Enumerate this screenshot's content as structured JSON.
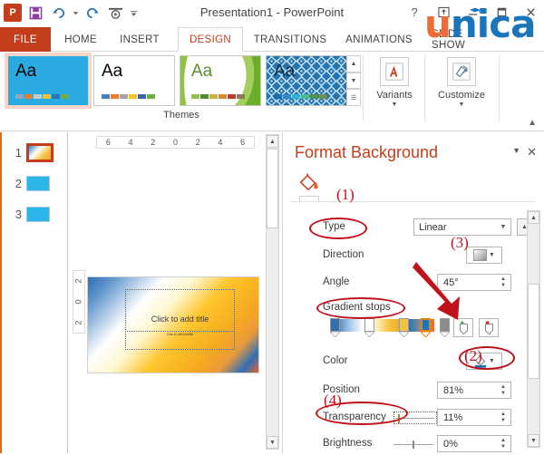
{
  "window": {
    "title": "Presentation1 - PowerPoint",
    "app_logo": "P",
    "quick_access": [
      {
        "name": "save-icon",
        "glyph": "ὋE"
      },
      {
        "name": "undo-icon",
        "glyph": "↶"
      },
      {
        "name": "redo-icon",
        "glyph": "↻"
      },
      {
        "name": "start-slideshow-icon",
        "glyph": "▷"
      },
      {
        "name": "customize-qat-icon",
        "glyph": "▾"
      }
    ],
    "controls": [
      {
        "name": "help-button",
        "glyph": "?"
      },
      {
        "name": "ribbon-display-options-button",
        "glyph": "⬆"
      },
      {
        "name": "minimize-button",
        "glyph": "–"
      },
      {
        "name": "restore-button",
        "glyph": "❐"
      },
      {
        "name": "close-button",
        "glyph": "✕"
      }
    ]
  },
  "watermark": {
    "first_letter": "u",
    "rest": "nica",
    "color_orange": "#ef6a35",
    "color_blue": "#1b75bb"
  },
  "tabs": {
    "file": "FILE",
    "items": [
      {
        "label": "HOME",
        "active": false
      },
      {
        "label": "INSERT",
        "active": false
      },
      {
        "label": "DESIGN",
        "active": true
      },
      {
        "label": "TRANSITIONS",
        "active": false
      },
      {
        "label": "ANIMATIONS",
        "active": false
      },
      {
        "label": "SLIDE SHOW",
        "active": false
      }
    ]
  },
  "ribbon": {
    "themes_label": "Themes",
    "themes": [
      {
        "name": "theme-office",
        "aa": "Aa",
        "selected": true,
        "swatches": [
          "#8fa6c0",
          "#e87d2a",
          "#c9c9c9",
          "#f2c130",
          "#2f6fb5",
          "#70ad47"
        ]
      },
      {
        "name": "theme-white",
        "aa": "Aa",
        "selected": false,
        "swatches": [
          "#4a7ebb",
          "#e87d2a",
          "#a6a6a6",
          "#f2c130",
          "#3a63a8",
          "#70ad47"
        ]
      },
      {
        "name": "theme-facet",
        "aa": "Aa",
        "selected": false,
        "swatches": [
          "#90c24a",
          "#4e8f2c",
          "#c8b43a",
          "#d98a2b",
          "#c0392b",
          "#8c7a5c"
        ]
      },
      {
        "name": "theme-berlin",
        "aa": "Aa",
        "selected": false,
        "swatches": [
          "#1b6ca8",
          "#2f86c6",
          "#35b2d4",
          "#4fb79a",
          "#4e8f5a",
          "#6b8f5a"
        ]
      }
    ],
    "variants": {
      "label": "Variants",
      "icon": "variants-icon"
    },
    "customize": {
      "label": "Customize",
      "icon": "customize-icon"
    },
    "collapse_icon": "collapse-ribbon-icon"
  },
  "slides": [
    {
      "number": "1",
      "selected": true
    },
    {
      "number": "2",
      "selected": false
    },
    {
      "number": "3",
      "selected": false
    }
  ],
  "editor": {
    "h_ruler": [
      "6",
      "4",
      "2",
      "0",
      "2",
      "4",
      "6"
    ],
    "v_ruler": [
      "2",
      "0",
      "2"
    ],
    "slide": {
      "title_placeholder": "Click to add title",
      "subtitle_placeholder": "Click to add subtitle"
    }
  },
  "pane": {
    "title": "Format Background",
    "close_icon": "close-icon",
    "dropdown_icon": "pane-options-icon",
    "fill_icon": "fill-bucket-icon",
    "rows": {
      "type": {
        "label": "Type",
        "value": "Linear"
      },
      "direction": {
        "label": "Direction",
        "value": "gradient-preview"
      },
      "angle": {
        "label": "Angle",
        "value": "45°"
      },
      "gradient_stops": {
        "label": "Gradient stops"
      },
      "color": {
        "label": "Color",
        "value": "fill-color-swatch"
      },
      "position": {
        "label": "Position",
        "value": "81%"
      },
      "transparency": {
        "label": "Transparency",
        "value": "11%"
      },
      "brightness": {
        "label": "Brightness",
        "value": "0%"
      }
    },
    "stop_buttons": {
      "add": "add-gradient-stop-icon",
      "remove": "remove-gradient-stop-icon"
    },
    "stops": [
      {
        "color": "#2f6fb5",
        "selected": false
      },
      {
        "color": "#ffffff",
        "selected": false
      },
      {
        "color": "#f5c242",
        "selected": false
      },
      {
        "color": "#f0b323",
        "selected": false
      },
      {
        "color": "#1b75bb",
        "selected": true
      },
      {
        "color": "#8c8c8c",
        "selected": false
      },
      {
        "color": "#ef7326",
        "selected": false
      }
    ]
  },
  "annotations": [
    {
      "name": "annotation-1",
      "label": "(1)",
      "target": "Type"
    },
    {
      "name": "annotation-2",
      "label": "(2)",
      "target": "Color"
    },
    {
      "name": "annotation-3",
      "label": "(3)",
      "target": "Add gradient stop"
    },
    {
      "name": "annotation-4",
      "label": "(4)",
      "target": "Transparency"
    }
  ]
}
